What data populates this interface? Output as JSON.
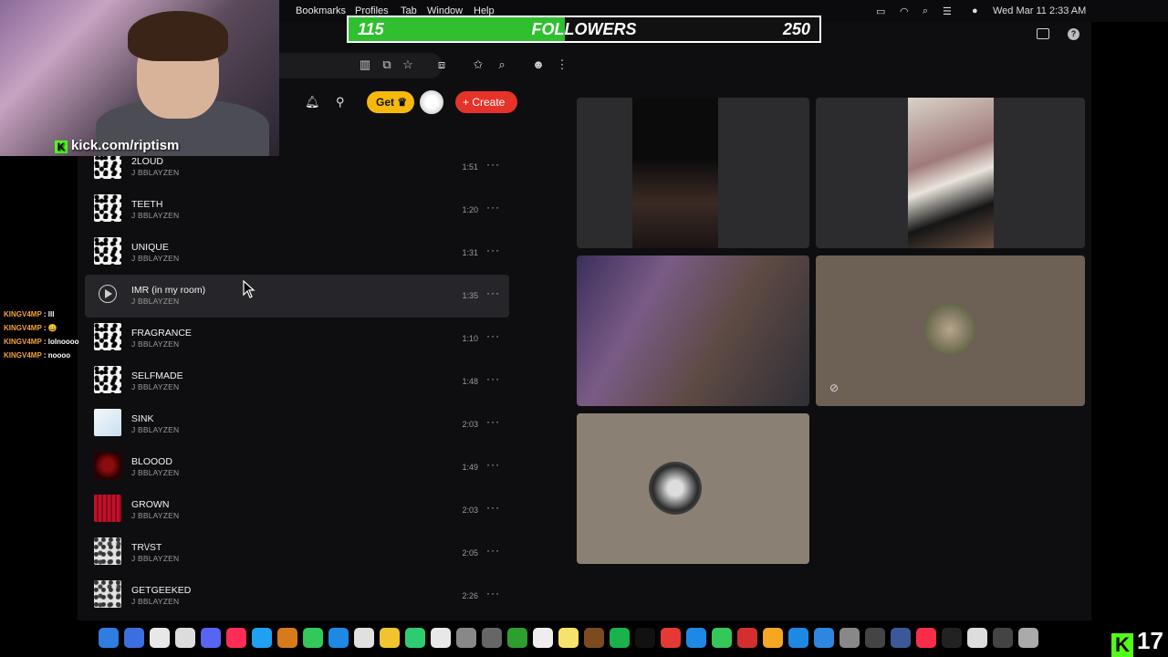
{
  "menubar": {
    "menus": [
      "Bookmarks",
      "Profiles",
      "Tab",
      "Window",
      "Help"
    ],
    "datetime": "Wed Mar 11  2:33 AM"
  },
  "goal": {
    "current": "115",
    "label": "FOLLOWERS",
    "target": "250",
    "progress_fraction": 0.46,
    "color": "#2fbf2f"
  },
  "youtube_header": {
    "get_label": "Get",
    "create_label": "+ Create"
  },
  "tracks": [
    {
      "title": "2LOUD",
      "artist": "J BBLAYZEN",
      "duration": "1:51",
      "thumb": "dots"
    },
    {
      "title": "TEETH",
      "artist": "J BBLAYZEN",
      "duration": "1:20",
      "thumb": "dots"
    },
    {
      "title": "UNIQUE",
      "artist": "J BBLAYZEN",
      "duration": "1:31",
      "thumb": "dots"
    },
    {
      "title": "IMR (in my room)",
      "artist": "J BBLAYZEN",
      "duration": "1:35",
      "thumb": "play",
      "hovered": true
    },
    {
      "title": "FRAGRANCE",
      "artist": "J BBLAYZEN",
      "duration": "1:10",
      "thumb": "dots"
    },
    {
      "title": "SELFMADE",
      "artist": "J BBLAYZEN",
      "duration": "1:48",
      "thumb": "dots"
    },
    {
      "title": "SINK",
      "artist": "J BBLAYZEN",
      "duration": "2:03",
      "thumb": "sink"
    },
    {
      "title": "BLOOOD",
      "artist": "J BBLAYZEN",
      "duration": "1:49",
      "thumb": "blood"
    },
    {
      "title": "GROWN",
      "artist": "J BBLAYZEN",
      "duration": "2:03",
      "thumb": "grown"
    },
    {
      "title": "TR\\/ST",
      "artist": "J BBLAYZEN",
      "duration": "2:05",
      "thumb": "grey"
    },
    {
      "title": "GETGEEKED",
      "artist": "J BBLAYZEN",
      "duration": "2:26",
      "thumb": "grey"
    }
  ],
  "webcam": {
    "kick_handle": "kick.com/riptism"
  },
  "chat": [
    {
      "user": "KINGV4MP",
      "text": "lll"
    },
    {
      "user": "KINGV4MP",
      "text": "😀"
    },
    {
      "user": "KINGV4MP",
      "text": "lolnoooo"
    },
    {
      "user": "KINGV4MP",
      "text": "noooo"
    }
  ],
  "viewers": {
    "count": "17"
  },
  "dock_colors": [
    "#2f7de1",
    "#3b6fe0",
    "#e8e8e8",
    "#dcdcdc",
    "#5865f2",
    "#ff2d55",
    "#1ea1f2",
    "#d87a1a",
    "#34c759",
    "#1e88e5",
    "#e0e0e0",
    "#f0c330",
    "#2ecc71",
    "#e8e8e8",
    "#888",
    "#666",
    "#2e9e2e",
    "#eee",
    "#f6e36b",
    "#7b4a1f",
    "#19b24b",
    "#111",
    "#e53935",
    "#1e88e5",
    "#34c759",
    "#d32f2f",
    "#f5a623",
    "#1e88e5",
    "#2e86de",
    "#888",
    "#444",
    "#3b5998",
    "#fa2d48",
    "#222",
    "#ddd",
    "#444",
    "#aaa"
  ]
}
